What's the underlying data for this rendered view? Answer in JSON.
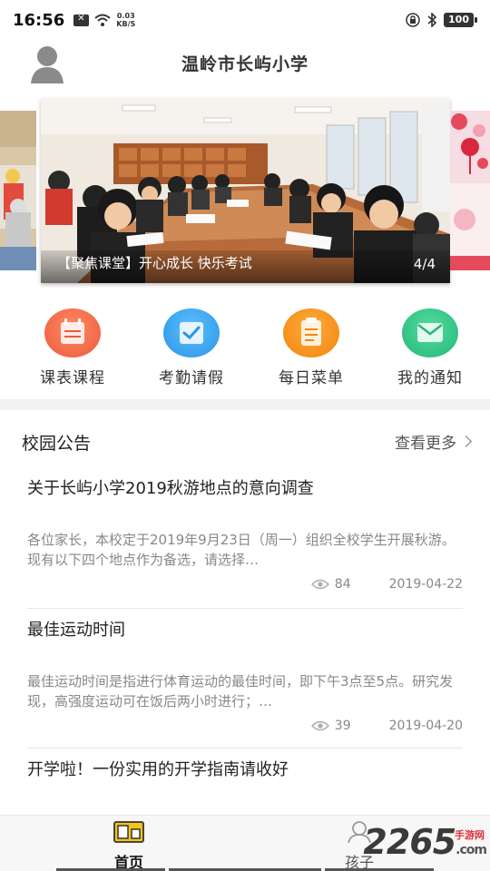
{
  "status_bar": {
    "time": "16:56",
    "net_speed_value": "0.03",
    "net_speed_unit": "KB/S",
    "battery": "100",
    "icons": [
      "message-icon",
      "wifi-icon",
      "lock-rotation-icon",
      "bluetooth-icon",
      "battery-icon"
    ]
  },
  "header": {
    "title": "温岭市长屿小学",
    "avatar_icon": "user-avatar-icon"
  },
  "banner": {
    "caption": "【聚焦课堂】开心成长 快乐考试",
    "counter": "4/4"
  },
  "quick_actions": [
    {
      "label": "课表课程",
      "icon": "schedule-icon",
      "color": "#f26a4b"
    },
    {
      "label": "考勤请假",
      "icon": "attendance-icon",
      "color": "#3aa6f0"
    },
    {
      "label": "每日菜单",
      "icon": "menu-icon",
      "color": "#f7941d"
    },
    {
      "label": "我的通知",
      "icon": "mail-icon",
      "color": "#2fc38a"
    }
  ],
  "notices": {
    "title": "校园公告",
    "see_more": "查看更多",
    "items": [
      {
        "title": "关于长屿小学2019秋游地点的意向调查",
        "summary": "各位家长，本校定于2019年9月23日（周一）组织全校学生开展秋游。现有以下四个地点作为备选，请选择…",
        "views": "84",
        "date": "2019-04-22"
      },
      {
        "title": "最佳运动时间",
        "summary": "最佳运动时间是指进行体育运动的最佳时间，即下午3点至5点。研究发现，高强度运动可在饭后两小时进行；…",
        "views": "39",
        "date": "2019-04-20"
      },
      {
        "title": "开学啦！一份实用的开学指南请收好"
      }
    ]
  },
  "bottom_nav": [
    {
      "label": "首页",
      "icon": "home-icon",
      "active": true
    },
    {
      "label": "孩子",
      "icon": "child-icon",
      "active": false
    }
  ],
  "watermark": {
    "number": "2265",
    "suffix": ".com",
    "site": "手游网"
  }
}
